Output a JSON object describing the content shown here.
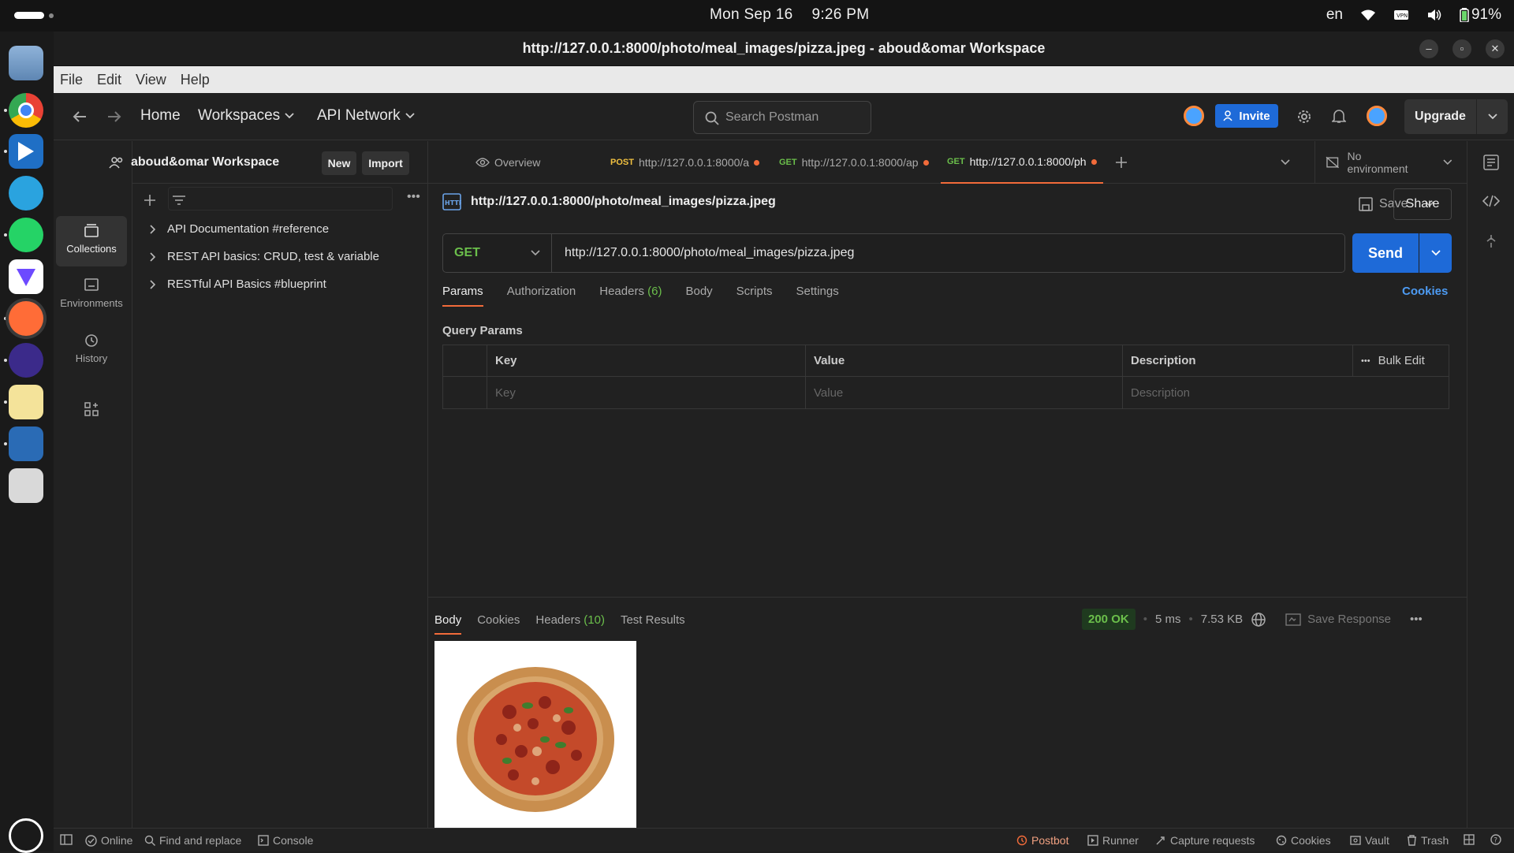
{
  "system": {
    "date": "Mon Sep 16",
    "time": "9:26 PM",
    "lang": "en",
    "battery": "91%"
  },
  "window": {
    "title": "http://127.0.0.1:8000/photo/meal_images/pizza.jpeg - aboud&omar Workspace"
  },
  "menu": [
    "File",
    "Edit",
    "View",
    "Help"
  ],
  "header": {
    "home": "Home",
    "workspaces": "Workspaces",
    "api_network": "API Network",
    "search_placeholder": "Search Postman",
    "invite": "Invite",
    "upgrade": "Upgrade"
  },
  "sidebar": {
    "workspace_name": "aboud&omar Workspace",
    "new_label": "New",
    "import_label": "Import",
    "nav": [
      {
        "label": "Collections",
        "icon": "collections-icon"
      },
      {
        "label": "Environments",
        "icon": "environments-icon"
      },
      {
        "label": "History",
        "icon": "history-icon"
      }
    ],
    "collections": [
      "API Documentation #reference",
      "REST API basics: CRUD, test & variable",
      "RESTful API Basics #blueprint"
    ]
  },
  "tabs": [
    {
      "method": "",
      "label": "Overview"
    },
    {
      "method": "POST",
      "label": "http://127.0.0.1:8000/a"
    },
    {
      "method": "GET",
      "label": "http://127.0.0.1:8000/ap"
    },
    {
      "method": "GET",
      "label": "http://127.0.0.1:8000/ph"
    }
  ],
  "environment": "No environment",
  "request": {
    "title": "http://127.0.0.1:8000/photo/meal_images/pizza.jpeg",
    "save": "Save",
    "share": "Share",
    "method": "GET",
    "url": "http://127.0.0.1:8000/photo/meal_images/pizza.jpeg",
    "send": "Send",
    "tabs": {
      "params": "Params",
      "authorization": "Authorization",
      "headers": "Headers",
      "headers_count": "(6)",
      "body": "Body",
      "scripts": "Scripts",
      "settings": "Settings"
    },
    "cookies": "Cookies",
    "query_params_label": "Query Params",
    "table": {
      "key": "Key",
      "value": "Value",
      "description": "Description",
      "bulk_edit": "Bulk Edit",
      "key_ph": "Key",
      "value_ph": "Value",
      "description_ph": "Description"
    }
  },
  "response": {
    "tabs": {
      "body": "Body",
      "cookies": "Cookies",
      "headers": "Headers",
      "headers_count": "(10)",
      "test_results": "Test Results"
    },
    "status": "200 OK",
    "time": "5 ms",
    "size": "7.53 KB",
    "save_response": "Save Response"
  },
  "statusbar": {
    "online": "Online",
    "find_replace": "Find and replace",
    "console": "Console",
    "postbot": "Postbot",
    "runner": "Runner",
    "capture": "Capture requests",
    "cookies": "Cookies",
    "vault": "Vault",
    "trash": "Trash"
  },
  "colors": {
    "accent": "#f26b3a",
    "primary": "#1e6ad8",
    "get_method": "#6bbf4b"
  }
}
